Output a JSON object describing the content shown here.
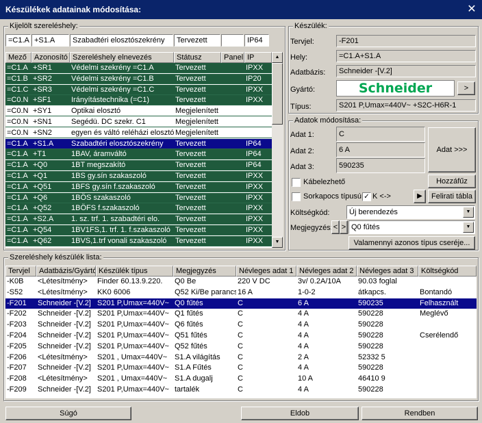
{
  "window": {
    "title": "Készülékek adatainak módosítása:"
  },
  "kijelolt": {
    "legend": "Kijelölt szereléshely:",
    "summary": [
      "=C1.A",
      "+S1.A",
      "Szabadtéri elosztószekrény",
      "Tervezett",
      "",
      "IP64"
    ],
    "headers": [
      "Mező",
      "Azonosító",
      "Szereléshely elnevezés",
      "Státusz",
      "Panel",
      "IP"
    ],
    "rows": [
      {
        "c": [
          "=C1.A",
          "+SR1",
          "Védelmi szekrény =C1.A",
          "Tervezett",
          "",
          "IPXX"
        ],
        "s": "g"
      },
      {
        "c": [
          "=C1.B",
          "+SR2",
          "Védelmi szekrény =C1.B",
          "Tervezett",
          "",
          "IP20"
        ],
        "s": "g"
      },
      {
        "c": [
          "=C1.C",
          "+SR3",
          "Védelmi szekrény =C1.C",
          "Tervezett",
          "",
          "IPXX"
        ],
        "s": "g"
      },
      {
        "c": [
          "=C0.N",
          "+SF1",
          "Irányítástechnika (=C1)",
          "Tervezett",
          "",
          "IPXX"
        ],
        "s": "g"
      },
      {
        "c": [
          "=C0.N",
          "+SY1",
          "Optikai elosztó",
          "Megjelenített",
          "",
          ""
        ],
        "s": "w"
      },
      {
        "c": [
          "=C0.N",
          "+SN1",
          "Segédü. DC szekr. C1",
          "Megjelenített",
          "",
          ""
        ],
        "s": "w"
      },
      {
        "c": [
          "=C0.N",
          "+SN2",
          "egyen és váltó reléházi  elosztó",
          "Megjelenített",
          "",
          ""
        ],
        "s": "w"
      },
      {
        "c": [
          "=C1.A",
          "+S1.A",
          "Szabadtéri elosztószekrény",
          "Tervezett",
          "",
          "IP64"
        ],
        "s": "b"
      },
      {
        "c": [
          "=C1.A",
          "+T1",
          "1BAV, áramváltó",
          "Tervezett",
          "",
          "IP64"
        ],
        "s": "g"
      },
      {
        "c": [
          "=C1.A",
          "+Q0",
          "1BT megszakító",
          "Tervezett",
          "",
          "IP64"
        ],
        "s": "g"
      },
      {
        "c": [
          "=C1.A",
          "+Q1",
          "1BS gy.sín szakaszoló",
          "Tervezett",
          "",
          "IPXX"
        ],
        "s": "g"
      },
      {
        "c": [
          "=C1.A",
          "+Q51",
          "1BFS gy.sín f.szakaszoló",
          "Tervezett",
          "",
          "IPXX"
        ],
        "s": "g"
      },
      {
        "c": [
          "=C1.A",
          "+Q6",
          "1BÖS szakaszoló",
          "Tervezett",
          "",
          "IPXX"
        ],
        "s": "g"
      },
      {
        "c": [
          "=C1.A",
          "+Q52",
          "1BÖFS f.szakaszoló",
          "Tervezett",
          "",
          "IPXX"
        ],
        "s": "g"
      },
      {
        "c": [
          "=C1.A",
          "+S2.A",
          "1. sz. trf. 1. szabadtéri elo.",
          "Tervezett",
          "",
          "IPXX"
        ],
        "s": "g"
      },
      {
        "c": [
          "=C1.A",
          "+Q54",
          "1BV1FS,1. trf. 1. f.szakaszoló",
          "Tervezett",
          "",
          "IPXX"
        ],
        "s": "g"
      },
      {
        "c": [
          "=C1.A",
          "+Q62",
          "1BVS,1.trf vonali szakaszoló",
          "Tervezett",
          "",
          "IPXX"
        ],
        "s": "g"
      }
    ]
  },
  "keszulek": {
    "legend": "Készülék:",
    "tervjel_label": "Tervjel:",
    "tervjel": "-F201",
    "hely_label": "Hely:",
    "hely": "=C1.A+S1.A",
    "adatbazis_label": "Adatbázis:",
    "adatbazis": "Schneider -[V.2]",
    "gyarto_label": "Gyártó:",
    "gyarto_logo": "Schneider",
    "gyarto_btn": ">",
    "tipus_label": "Típus:",
    "tipus": "S201 P,Umax=440V~ +S2C-H6R-1"
  },
  "adatok": {
    "legend": "Adatok módosítása:",
    "adat1_label": "Adat 1:",
    "adat1": "C",
    "adat2_label": "Adat 2:",
    "adat2": "6 A",
    "adat3_label": "Adat 3:",
    "adat3": "590235",
    "adat_btn": "Adat >>>",
    "kabelezheto": "Kábelezhető",
    "hozzafuz": "Hozzáfűz",
    "sorkapocs": "Sorkapocs típusú",
    "k_label": "K <->",
    "play": "▶",
    "felirati": "Felirati tábla",
    "koltseg_label": "Költségkód:",
    "koltseg": "Új berendezés",
    "megjegyzes_label": "Megjegyzés:",
    "megjegyzes": "Q0 fűtés",
    "prev": "<",
    "next": ">",
    "valamennyi": "Valamennyi azonos típus cseréje..."
  },
  "lista": {
    "legend": "Szereléshely készülék lista:",
    "headers": [
      "Tervjel",
      "Adatbázis/Gyártó",
      "Készülék típus",
      "Megjegyzés",
      "Névleges adat 1",
      "Névleges adat 2",
      "Névleges adat 3",
      "Költségkód"
    ],
    "rows": [
      [
        "-K0B",
        "<Létesítmény>",
        "Finder 60.13.9.220.",
        "Q0 Be",
        "220 V DC",
        "3v/ 0.2A/10A",
        "90.03 foglal",
        ""
      ],
      [
        "-S52",
        "<Létesítmény>",
        "KK0 6006",
        "Q52 Ki/Be parancs",
        "16 A",
        "1-0-2",
        "átkapcs.",
        "Bontandó"
      ],
      [
        "-F201",
        "Schneider -[V.2]",
        "S201 P,Umax=440V~",
        "Q0 fűtés",
        "C",
        "6 A",
        "590235",
        "Felhasznált"
      ],
      [
        "-F202",
        "Schneider -[V.2]",
        "S201 P,Umax=440V~",
        "Q1 fűtés",
        "C",
        "4 A",
        "590228",
        "Meglévő"
      ],
      [
        "-F203",
        "Schneider -[V.2]",
        "S201 P,Umax=440V~",
        "Q6 fűtés",
        "C",
        "4 A",
        "590228",
        ""
      ],
      [
        "-F204",
        "Schneider -[V.2]",
        "S201 P,Umax=440V~",
        "Q51 fűtés",
        "C",
        "4 A",
        "590228",
        "Cserélendő"
      ],
      [
        "-F205",
        "Schneider -[V.2]",
        "S201 P,Umax=440V~",
        "Q52 fűtés",
        "C",
        "4 A",
        "590228",
        ""
      ],
      [
        "-F206",
        "<Létesítmény>",
        "S201 , Umax=440V~",
        "S1.A világítás",
        "C",
        "2 A",
        "52332 5",
        ""
      ],
      [
        "-F207",
        "Schneider -[V.2]",
        "S201 P,Umax=440V~",
        "S1.A Fűtés",
        "C",
        "4 A",
        "590228",
        ""
      ],
      [
        "-F208",
        "<Létesítmény>",
        "S201 , Umax=440V~",
        "S1.A dugalj",
        "C",
        "10 A",
        "46410 9",
        ""
      ],
      [
        "-F209",
        "Schneider -[V.2]",
        "S201 P,Umax=440V~",
        "tartalék",
        "C",
        "4 A",
        "590228",
        ""
      ]
    ],
    "selected": 2
  },
  "footer": {
    "sugo": "Súgó",
    "eldob": "Eldob",
    "rendben": "Rendben"
  },
  "colors": {
    "title": "#0a246a",
    "green": "#1f5a3c",
    "select": "#0a0a8c",
    "schneider": "#00a651"
  }
}
